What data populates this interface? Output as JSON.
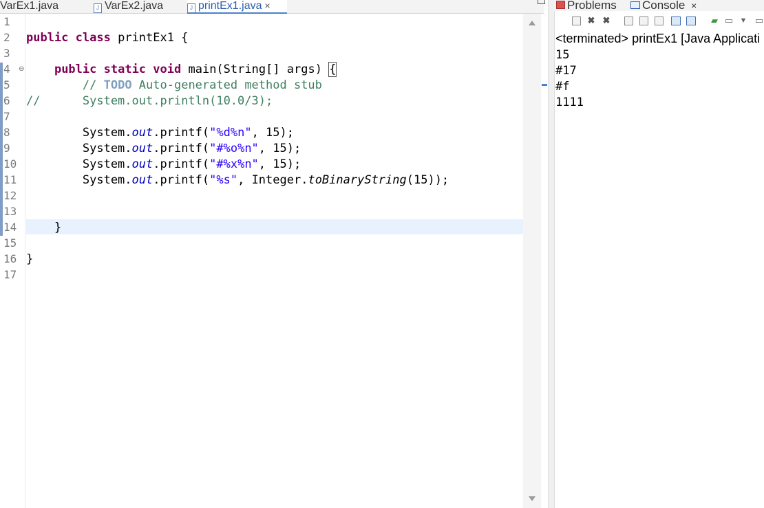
{
  "editor": {
    "tabs": [
      {
        "label": "VarEx1.java",
        "active": false
      },
      {
        "label": "VarEx2.java",
        "active": false
      },
      {
        "label": "printEx1.java",
        "active": true,
        "close": "×"
      }
    ],
    "line_numbers": [
      "1",
      "2",
      "3",
      "4",
      "5",
      "6",
      "7",
      "8",
      "9",
      "10",
      "11",
      "12",
      "13",
      "14",
      "15",
      "16",
      "17"
    ],
    "fold_marker": "⊖",
    "code": {
      "l2": {
        "kw1": "public",
        "kw2": "class",
        "rest": " printEx1 {"
      },
      "l4": {
        "indent": "    ",
        "kw1": "public",
        "kw2": "static",
        "kw3": "void",
        "rest": " main(String[] args) ",
        "brace": "{"
      },
      "l5": {
        "indent": "        ",
        "comment1": "// ",
        "todo": "TODO",
        "comment2": " Auto-generated method stub"
      },
      "l6": {
        "comment": "//      System.out.println(10.0/3);"
      },
      "l8": {
        "indent": "        System.",
        "field": "out",
        "call": ".printf(",
        "str": "\"%d%n\"",
        "rest": ", 15);"
      },
      "l9": {
        "indent": "        System.",
        "field": "out",
        "call": ".printf(",
        "str": "\"#%o%n\"",
        "rest": ", 15);"
      },
      "l10": {
        "indent": "        System.",
        "field": "out",
        "call": ".printf(",
        "str": "\"#%x%n\"",
        "rest": ", 15);"
      },
      "l11": {
        "indent": "        System.",
        "field": "out",
        "call": ".printf(",
        "str": "\"%s\"",
        "mid": ", Integer.",
        "method": "toBinaryString",
        "rest": "(15));"
      },
      "l14": {
        "text": "    }"
      },
      "l16": {
        "text": "}"
      }
    }
  },
  "console": {
    "tabs": [
      {
        "label": "Problems"
      },
      {
        "label": "Console",
        "close": "×"
      }
    ],
    "toolbar_icons": [
      "terminate-icon",
      "remove-launch-icon",
      "remove-all-icon",
      "scroll-lock-icon",
      "word-wrap-icon",
      "show-console-icon",
      "pin-console-icon",
      "open-console-icon",
      "display-console-icon",
      "view-menu-icon"
    ],
    "header": "<terminated> printEx1 [Java Applicati",
    "output": [
      "15",
      "#17",
      "#f",
      "1111"
    ]
  },
  "colors": {
    "keyword": "#7f0055",
    "comment": "#3f7f5f",
    "string": "#2a00ff",
    "field": "#0000c0",
    "current_line": "#e8f2fe"
  }
}
